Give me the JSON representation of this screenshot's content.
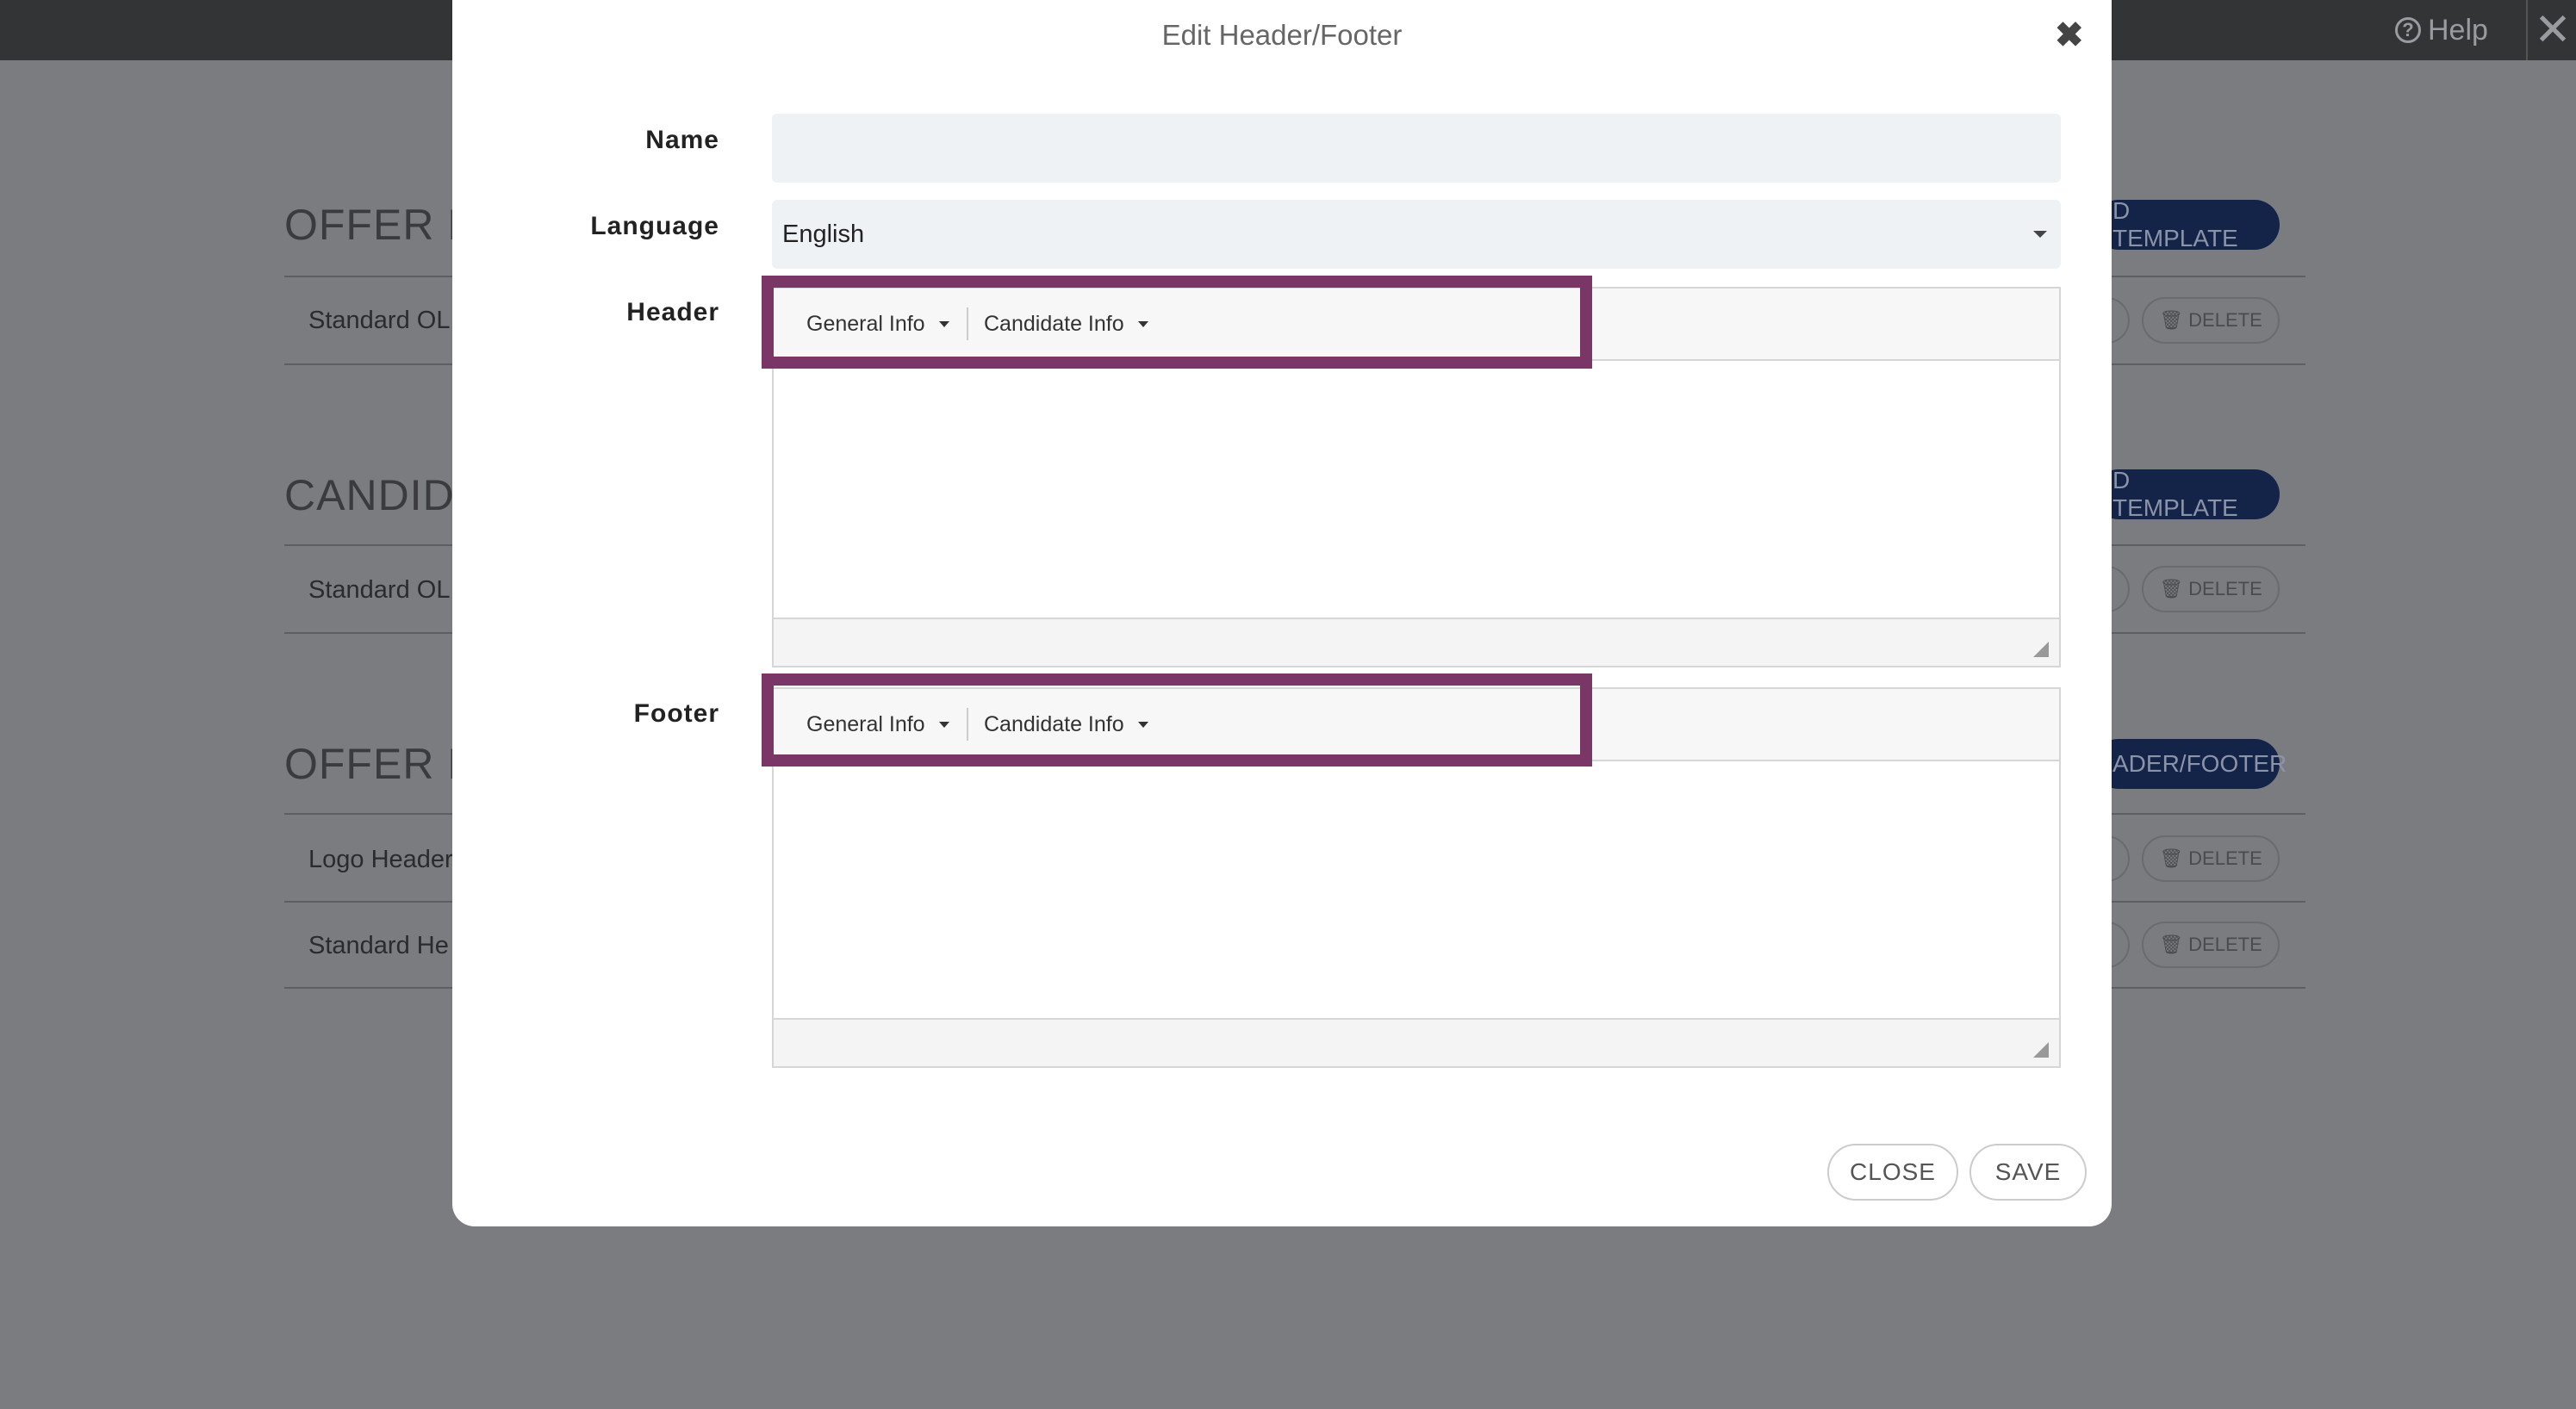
{
  "topbar": {
    "help_label": "Help"
  },
  "background": {
    "sections": [
      {
        "title": "OFFER LE",
        "button": "D TEMPLATE",
        "rows": [
          "Standard OL"
        ]
      },
      {
        "title": "CANDIDA",
        "button": "D TEMPLATE",
        "rows": [
          "Standard OL"
        ]
      },
      {
        "title": "OFFER LE",
        "button": "ADER/FOOTER",
        "rows": [
          "Logo Header",
          "Standard He"
        ]
      }
    ],
    "delete_label": "DELETE"
  },
  "modal": {
    "title": "Edit Header/Footer",
    "name": {
      "label": "Name",
      "value": ""
    },
    "language": {
      "label": "Language",
      "value": "English"
    },
    "header": {
      "label": "Header",
      "toolbar": [
        "General Info",
        "Candidate Info"
      ]
    },
    "footer": {
      "label": "Footer",
      "toolbar": [
        "General Info",
        "Candidate Info"
      ]
    },
    "close_label": "CLOSE",
    "save_label": "SAVE"
  },
  "colors": {
    "highlight": "#7b3668",
    "accent_button": "#142348"
  }
}
